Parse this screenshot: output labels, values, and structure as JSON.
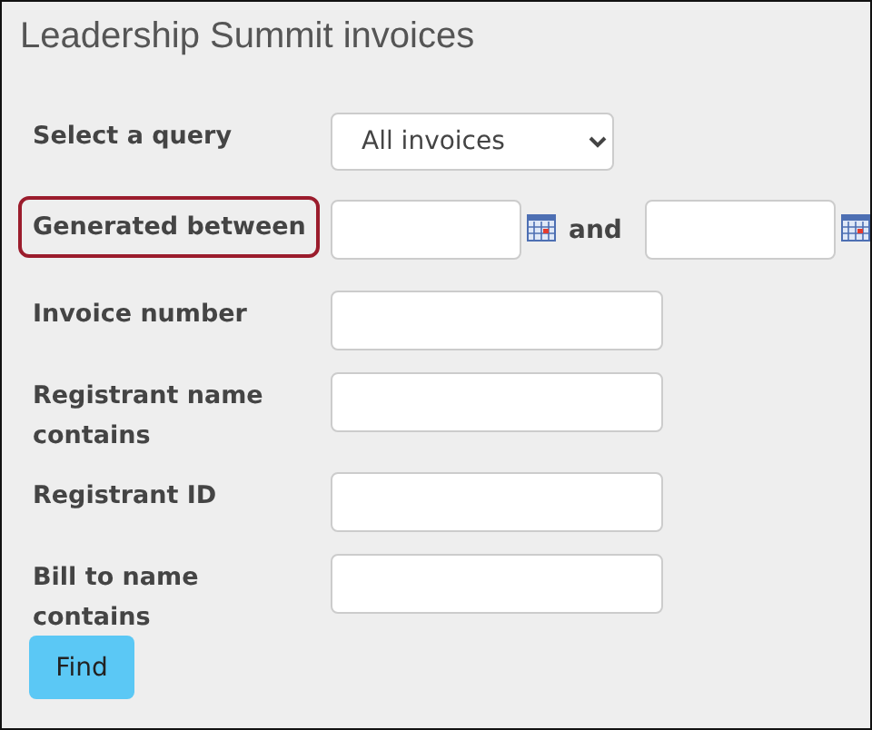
{
  "title": "Leadership Summit invoices",
  "fields": [
    {
      "kind": "select",
      "label": "Select a query",
      "highlighted": false,
      "value": "All invoices"
    },
    {
      "kind": "daterange",
      "label": "Generated between",
      "highlighted": true,
      "joiner": "and"
    },
    {
      "kind": "text",
      "label": "Invoice number",
      "highlighted": false
    },
    {
      "kind": "text",
      "label": "Registrant name contains",
      "highlighted": false
    },
    {
      "kind": "text",
      "label": "Registrant ID",
      "highlighted": false
    },
    {
      "kind": "text",
      "label": "Bill to name contains",
      "highlighted": false
    }
  ],
  "button": "Find"
}
